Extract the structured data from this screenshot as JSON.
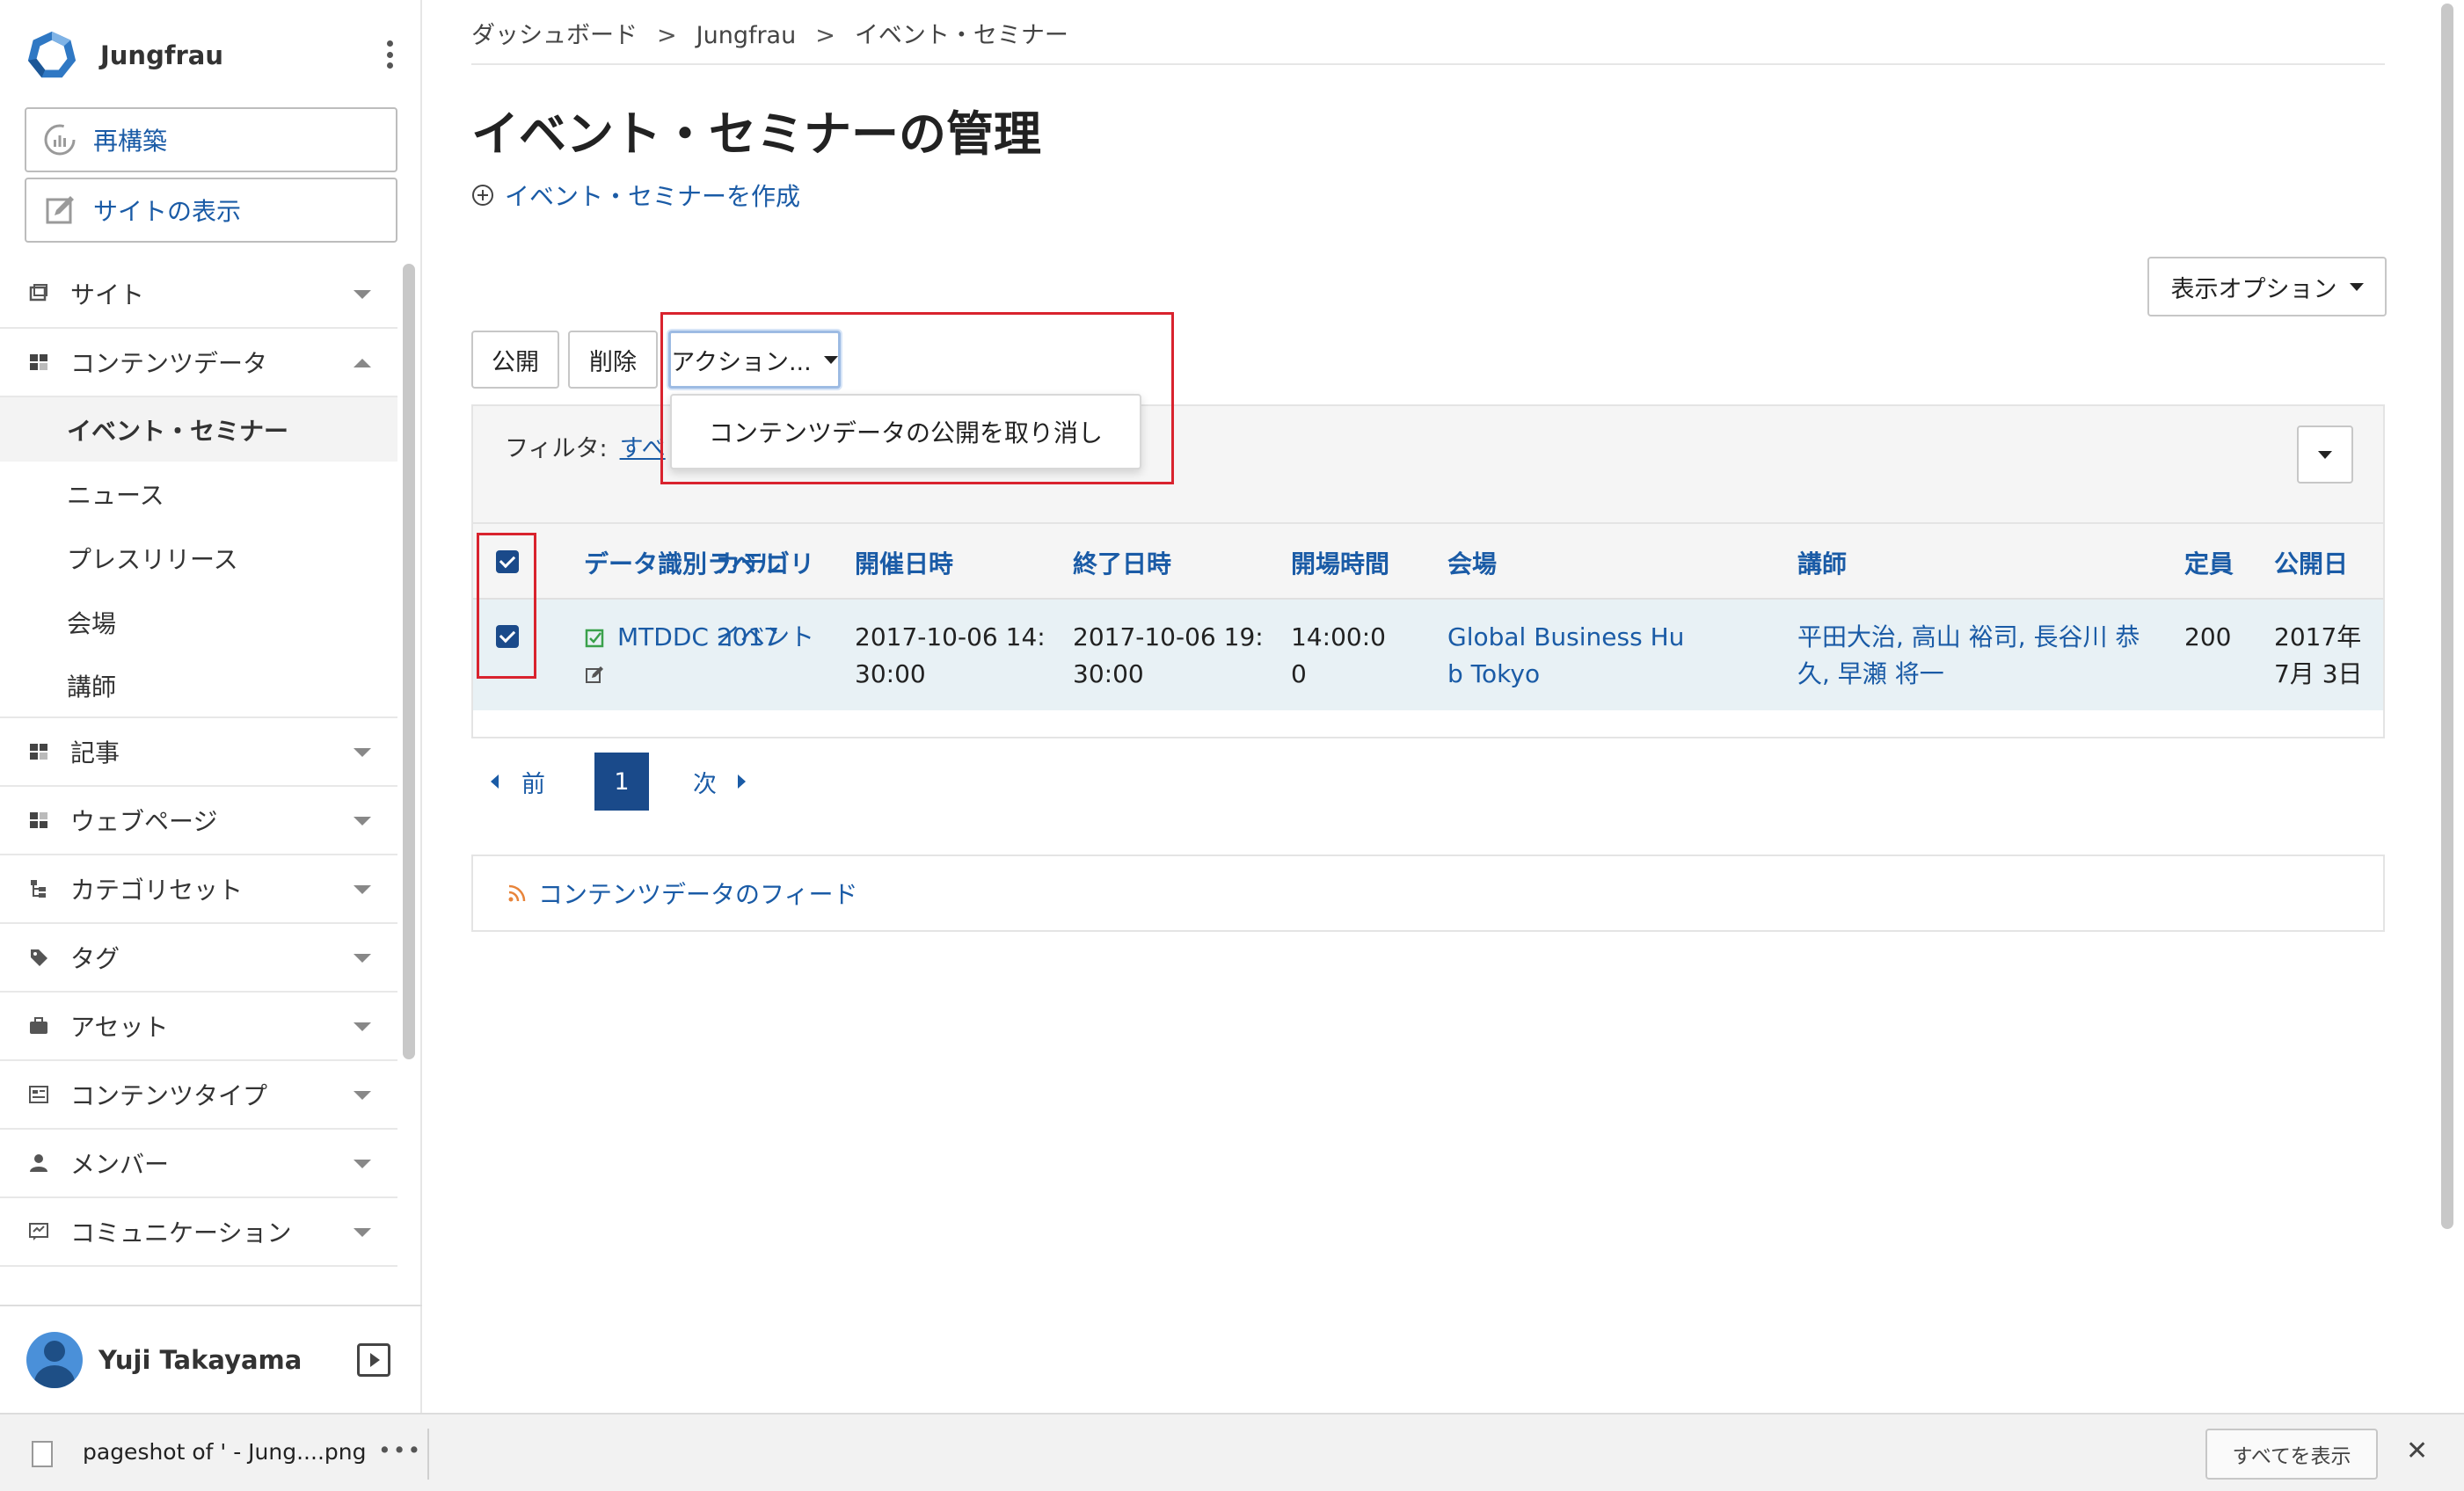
{
  "sidebar": {
    "site_name": "Jungfrau",
    "rebuild_label": "再構築",
    "view_site_label": "サイトの表示",
    "groups": [
      {
        "label": "サイト",
        "icon": "site-icon"
      },
      {
        "label": "コンテンツデータ",
        "icon": "content-data-icon",
        "expanded": true
      },
      {
        "label": "記事",
        "icon": "entries-icon"
      },
      {
        "label": "ウェブページ",
        "icon": "webpages-icon"
      },
      {
        "label": "カテゴリセット",
        "icon": "category-set-icon"
      },
      {
        "label": "タグ",
        "icon": "tag-icon"
      },
      {
        "label": "アセット",
        "icon": "asset-icon"
      },
      {
        "label": "コンテンツタイプ",
        "icon": "content-type-icon"
      },
      {
        "label": "メンバー",
        "icon": "member-icon"
      },
      {
        "label": "コミュニケーション",
        "icon": "communication-icon"
      }
    ],
    "content_data_items": [
      "イベント・セミナー",
      "ニュース",
      "プレスリリース",
      "会場",
      "講師"
    ],
    "user_name": "Yuji Takayama"
  },
  "breadcrumb": [
    "ダッシュボード",
    "Jungfrau",
    "イベント・セミナー"
  ],
  "page": {
    "title": "イベント・セミナーの管理",
    "create_link": "イベント・セミナーを作成",
    "display_options": "表示オプション"
  },
  "toolbar": {
    "publish": "公開",
    "delete": "削除",
    "actions": "アクション..."
  },
  "actions_menu": {
    "items": [
      "コンテンツデータの公開を取り消し"
    ]
  },
  "filter": {
    "label": "フィルタ:",
    "value": "すべ"
  },
  "table": {
    "columns": [
      "データ識別ラベル",
      "カテゴリ",
      "開催日時",
      "終了日時",
      "開場時間",
      "会場",
      "講師",
      "定員",
      "公開日"
    ],
    "rows": [
      {
        "selected": true,
        "label": "MTDDC 2017",
        "category": "イベント",
        "start_l1": "2017-10-06 14:",
        "start_l2": "30:00",
        "end_l1": "2017-10-06 19:",
        "end_l2": "30:00",
        "open_l1": "14:00:0",
        "open_l2": "0",
        "venue_l1": "Global Business Hu",
        "venue_l2": "b Tokyo",
        "lecturers_l1": "平田大治, 高山 裕司, 長谷川 恭",
        "lecturers_l2": "久, 早瀬 将一",
        "capacity": "200",
        "published_l1": "2017年",
        "published_l2": "7月 3日"
      }
    ]
  },
  "pagination": {
    "prev": "前",
    "current": "1",
    "next": "次"
  },
  "feed": {
    "label": "コンテンツデータのフィード"
  },
  "download_bar": {
    "file_name": "pageshot of ' - Jung....png",
    "more": "•••",
    "show_all": "すべてを表示",
    "close": "✕"
  },
  "colors": {
    "link": "#1a5ba6",
    "primary_dark": "#1a4a8a",
    "highlight": "#d9232e",
    "row_selected": "#e8f1f5",
    "feed_icon": "#e8843a"
  }
}
